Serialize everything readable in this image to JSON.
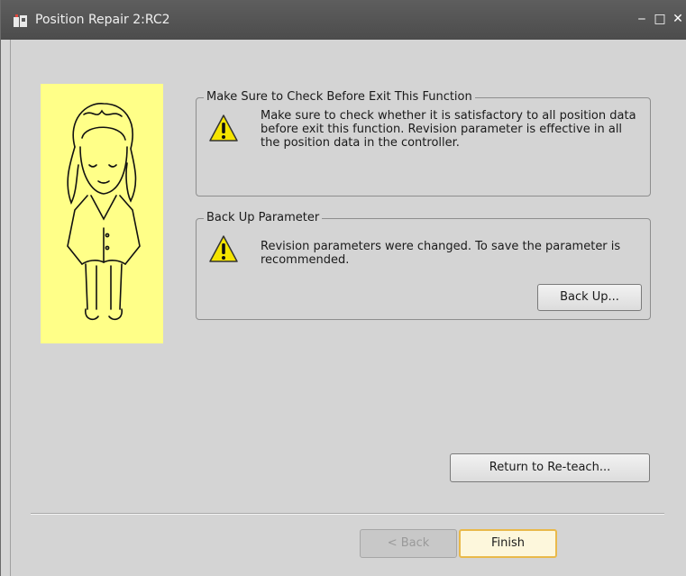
{
  "window": {
    "title": "Position Repair 2:RC2",
    "minimize_glyph": "‒",
    "maximize_glyph": "□",
    "close_glyph": "✕"
  },
  "groups": [
    {
      "legend": "Make Sure to Check Before Exit This Function",
      "icon": "warning-icon",
      "text": "Make sure to check whether it is satisfactory to all position data before exit this function. Revision parameter is effective in all the position data in the controller."
    },
    {
      "legend": "Back Up Parameter",
      "icon": "warning-icon",
      "text": "Revision parameters were changed. To save the parameter is recommended.",
      "button_label": "Back Up..."
    }
  ],
  "buttons": {
    "return_to_reteach": "Return to Re-teach...",
    "back": "< Back",
    "finish": "Finish"
  },
  "colors": {
    "illustration_bg": "#ffff88",
    "warning_fill": "#f5e400",
    "finish_border": "#e9b94a"
  }
}
